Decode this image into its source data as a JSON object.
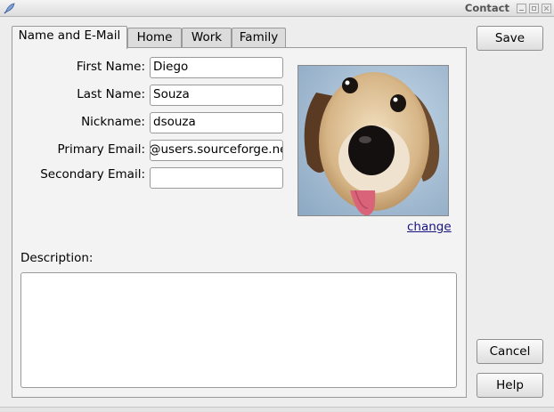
{
  "window": {
    "title": "Contact",
    "app_icon": "feather-icon",
    "controls": [
      "minimize-icon",
      "maximize-icon",
      "close-icon"
    ]
  },
  "tabs": [
    {
      "label": "Name and E-Mail",
      "active": true
    },
    {
      "label": "Home",
      "active": false
    },
    {
      "label": "Work",
      "active": false
    },
    {
      "label": "Family",
      "active": false
    }
  ],
  "form": {
    "first_name": {
      "label": "First Name:",
      "value": "Diego"
    },
    "last_name": {
      "label": "Last Name:",
      "value": "Souza"
    },
    "nickname": {
      "label": "Nickname:",
      "value": "dsouza"
    },
    "primary_email": {
      "label": "Primary Email:",
      "value": "@users.sourceforge.net"
    },
    "secondary_email": {
      "label": "Secondary Email:",
      "value": ""
    },
    "description": {
      "label": "Description:",
      "value": ""
    }
  },
  "photo": {
    "change_label": "change"
  },
  "buttons": {
    "save": "Save",
    "cancel": "Cancel",
    "help": "Help"
  }
}
